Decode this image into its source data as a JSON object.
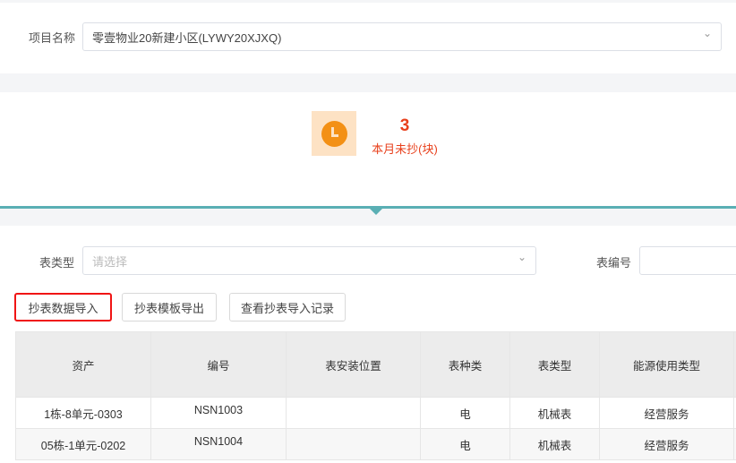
{
  "project": {
    "label": "项目名称",
    "value": "零壹物业20新建小区(LYWY20XJXQ)"
  },
  "stat": {
    "icon": "clock-icon",
    "count": "3",
    "label": "本月未抄(块)",
    "color": "#e8401c"
  },
  "filters": {
    "meter_type_label": "表类型",
    "meter_type_placeholder": "请选择",
    "meter_no_label": "表编号",
    "meter_no_value": ""
  },
  "actions": {
    "import": "抄表数据导入",
    "export_template": "抄表模板导出",
    "import_records": "查看抄表导入记录"
  },
  "table": {
    "headers": [
      "资产",
      "编号",
      "表安装位置",
      "表种类",
      "表类型",
      "能源使用类型"
    ],
    "rows": [
      [
        "1栋-8单元-0303",
        "NSN1003",
        "",
        "电",
        "机械表",
        "经营服务"
      ],
      [
        "05栋-1单元-0202",
        "NSN1004",
        "",
        "电",
        "机械表",
        "经营服务"
      ]
    ]
  }
}
